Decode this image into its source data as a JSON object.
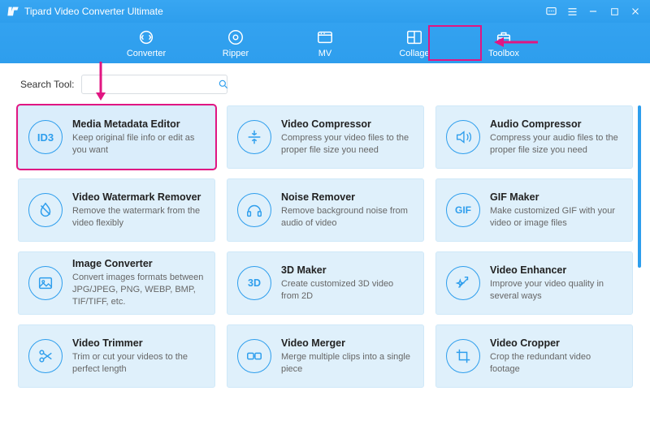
{
  "titlebar": {
    "title": "Tipard Video Converter Ultimate"
  },
  "tabs": [
    {
      "label": "Converter"
    },
    {
      "label": "Ripper"
    },
    {
      "label": "MV"
    },
    {
      "label": "Collage"
    },
    {
      "label": "Toolbox"
    }
  ],
  "search": {
    "label": "Search Tool:",
    "placeholder": ""
  },
  "tools": [
    {
      "icon": "ID3",
      "title": "Media Metadata Editor",
      "desc": "Keep original file info or edit as you want"
    },
    {
      "icon": "compress",
      "title": "Video Compressor",
      "desc": "Compress your video files to the proper file size you need"
    },
    {
      "icon": "audio",
      "title": "Audio Compressor",
      "desc": "Compress your audio files to the proper file size you need"
    },
    {
      "icon": "watermark",
      "title": "Video Watermark Remover",
      "desc": "Remove the watermark from the video flexibly"
    },
    {
      "icon": "noise",
      "title": "Noise Remover",
      "desc": "Remove background noise from audio of video"
    },
    {
      "icon": "GIF",
      "title": "GIF Maker",
      "desc": "Make customized GIF with your video or image files"
    },
    {
      "icon": "image",
      "title": "Image Converter",
      "desc": "Convert images formats between JPG/JPEG, PNG, WEBP, BMP, TIF/TIFF, etc."
    },
    {
      "icon": "3D",
      "title": "3D Maker",
      "desc": "Create customized 3D video from 2D"
    },
    {
      "icon": "enhance",
      "title": "Video Enhancer",
      "desc": "Improve your video quality in several ways"
    },
    {
      "icon": "trim",
      "title": "Video Trimmer",
      "desc": "Trim or cut your videos to the perfect length"
    },
    {
      "icon": "merge",
      "title": "Video Merger",
      "desc": "Merge multiple clips into a single piece"
    },
    {
      "icon": "crop",
      "title": "Video Cropper",
      "desc": "Crop the redundant video footage"
    }
  ]
}
